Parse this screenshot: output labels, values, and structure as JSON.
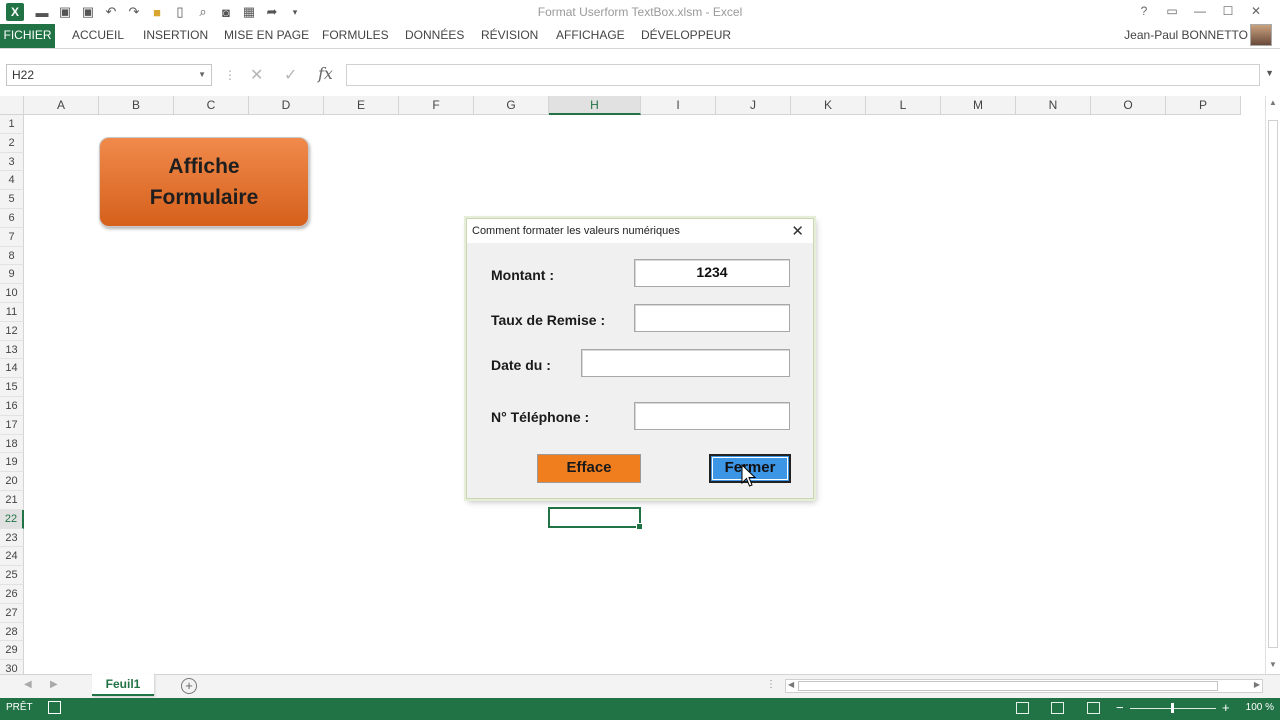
{
  "window": {
    "title": "Format Userform TextBox.xlsm - Excel",
    "help": "?",
    "restore": "▭",
    "minimize": "—",
    "maximize": "☐",
    "close": "✕"
  },
  "quick_access": {
    "excel_logo": "X",
    "icons": [
      "open-icon",
      "save-icon",
      "save-as-icon",
      "undo-icon",
      "redo-icon",
      "folder-icon",
      "new-doc-icon",
      "print-preview-icon",
      "camera-icon",
      "calculator-icon",
      "send-icon",
      "customize-icon"
    ]
  },
  "ribbon": {
    "tabs": [
      "FICHIER",
      "ACCUEIL",
      "INSERTION",
      "MISE EN PAGE",
      "FORMULES",
      "DONNÉES",
      "RÉVISION",
      "AFFICHAGE",
      "DÉVELOPPEUR"
    ],
    "user": "Jean-Paul BONNETTO"
  },
  "formula_bar": {
    "name_box": "H22",
    "fx": "fx",
    "formula": ""
  },
  "sheet": {
    "columns": [
      "A",
      "B",
      "C",
      "D",
      "E",
      "F",
      "G",
      "H",
      "I",
      "J",
      "K",
      "L",
      "M",
      "N",
      "O",
      "P"
    ],
    "rows": [
      "1",
      "2",
      "3",
      "4",
      "5",
      "6",
      "7",
      "8",
      "9",
      "10",
      "11",
      "12",
      "13",
      "14",
      "15",
      "16",
      "17",
      "18",
      "19",
      "20",
      "21",
      "22",
      "23",
      "24",
      "25",
      "26",
      "27",
      "28",
      "29",
      "30"
    ],
    "selected_column": "H",
    "selected_row": "22",
    "shape_button": {
      "line1": "Affiche",
      "line2": "Formulaire"
    }
  },
  "dialog": {
    "title": "Comment formater les valeurs numériques",
    "fields": [
      {
        "label": "Montant :",
        "value": "1234"
      },
      {
        "label": "Taux de Remise  :",
        "value": ""
      },
      {
        "label": "Date du :",
        "value": ""
      },
      {
        "label": "N° Téléphone :",
        "value": ""
      }
    ],
    "button_clear": "Efface",
    "button_close": "Fermer",
    "colors": {
      "clear_button": "#f07e1e",
      "close_button": "#3d95e6"
    }
  },
  "sheet_tabs": {
    "tabs": [
      "Feuil1"
    ],
    "active": "Feuil1"
  },
  "status_bar": {
    "status": "PRÊT",
    "zoom": "100 %"
  },
  "colors": {
    "accent": "#217346"
  }
}
